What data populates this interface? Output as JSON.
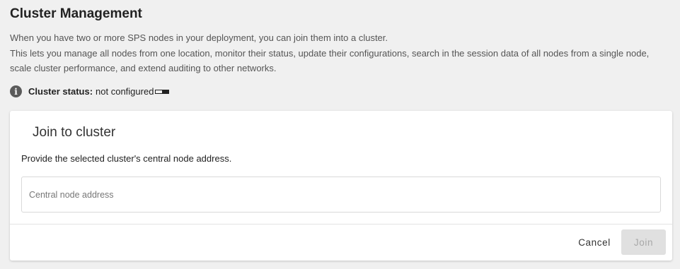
{
  "header": {
    "title": "Cluster Management",
    "description_line1": "When you have two or more SPS nodes in your deployment, you can join them into a cluster.",
    "description_line2": "This lets you manage all nodes from one location, monitor their status, update their configurations, search in the session data of all nodes from a single node, scale cluster performance, and extend auditing to other networks."
  },
  "status": {
    "icon": "info-icon",
    "label": "Cluster status:",
    "value": "not configured"
  },
  "join_card": {
    "title": "Join to cluster",
    "instruction": "Provide the selected cluster's central node address.",
    "address_input": {
      "value": "",
      "placeholder": "Central node address"
    },
    "cancel_label": "Cancel",
    "join_label": "Join",
    "join_disabled": true
  },
  "colors": {
    "background": "#f0f0f0",
    "card": "#ffffff",
    "disabled_button": "#e0e0e0"
  }
}
